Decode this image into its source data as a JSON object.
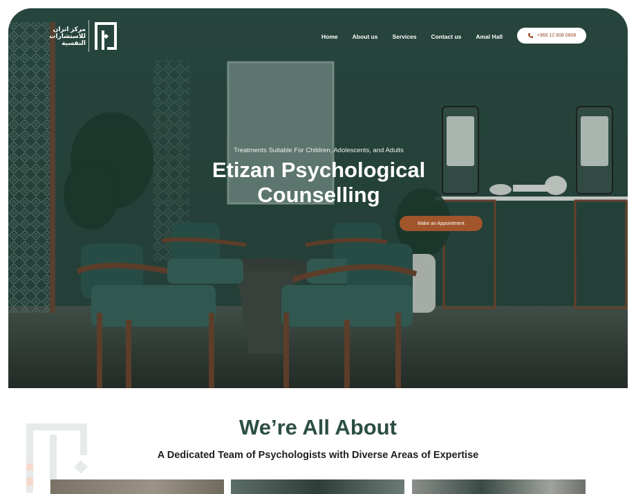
{
  "header": {
    "logo_text": "مركز اتزان للاستشارات النفسية",
    "nav": [
      "Home",
      "About us",
      "Services",
      "Contact us",
      "Amal Hall"
    ],
    "phone": "+966 12 608 0808"
  },
  "hero": {
    "subtitle": "Treatments Suitable For Children, Adolescents, and Adults",
    "title_line1": "Etizan Psychological",
    "title_line2": "Counselling",
    "cta_label": "Make an Appointment"
  },
  "about": {
    "title": "We’re All About",
    "subtitle": "A Dedicated Team of Psychologists with Diverse Areas of Expertise"
  },
  "colors": {
    "brand_green": "#2c4e45",
    "accent_copper": "#a2552b",
    "white": "#ffffff"
  },
  "icons": [
    "phone-icon",
    "logo-mark-icon",
    "logo-watermark-icon"
  ]
}
